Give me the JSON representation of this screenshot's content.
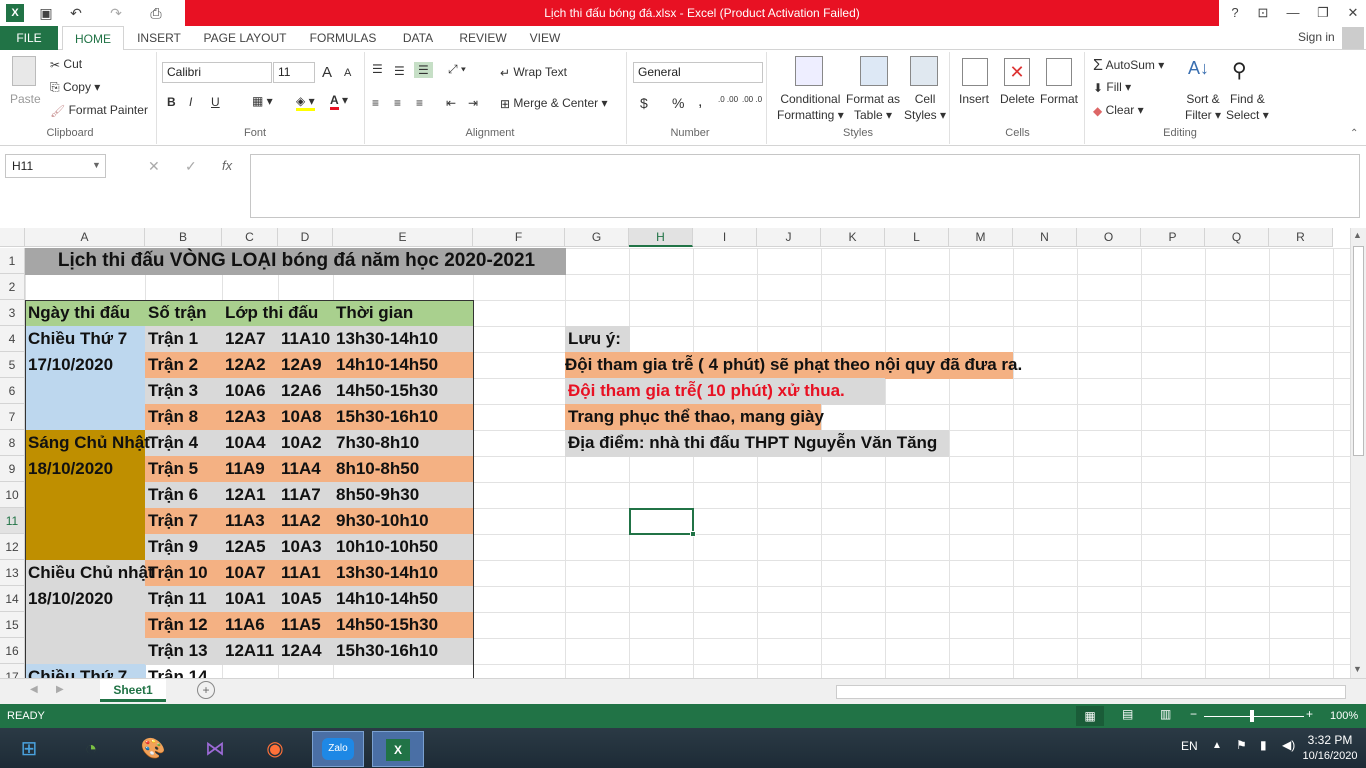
{
  "window": {
    "title": "Lịch thi đấu bóng đá.xlsx -  Excel (Product Activation Failed)",
    "help": "?",
    "signin": "Sign in"
  },
  "tabs": [
    "FILE",
    "HOME",
    "INSERT",
    "PAGE LAYOUT",
    "FORMULAS",
    "DATA",
    "REVIEW",
    "VIEW"
  ],
  "ribbon": {
    "clipboard": {
      "paste": "Paste",
      "cut": "Cut",
      "copy": "Copy",
      "format_painter": "Format Painter",
      "label": "Clipboard"
    },
    "font": {
      "name": "Calibri",
      "size": "11",
      "bold": "B",
      "italic": "I",
      "underline": "U",
      "label": "Font",
      "grow": "A",
      "shrink": "A",
      "color_a": "A"
    },
    "alignment": {
      "wrap": "Wrap Text",
      "merge": "Merge & Center",
      "label": "Alignment"
    },
    "number": {
      "format": "General",
      "currency": "$",
      "percent": "%",
      "comma": ",",
      "label": "Number",
      "inc": ".0 .00",
      "dec": ".00 .0"
    },
    "styles": {
      "conditional": "Conditional",
      "formatting": "Formatting",
      "format_as": "Format as",
      "table": "Table",
      "cell": "Cell",
      "cstyles": "Styles",
      "label": "Styles"
    },
    "cells": {
      "insert": "Insert",
      "delete": "Delete",
      "format": "Format",
      "label": "Cells"
    },
    "editing": {
      "autosum": "AutoSum",
      "fill": "Fill",
      "clear": "Clear",
      "sort": "Sort &",
      "filter": "Filter",
      "find": "Find &",
      "select": "Select",
      "label": "Editing"
    }
  },
  "formula_bar": {
    "name_box": "H11",
    "cancel": "✕",
    "enter": "✓",
    "fx": "fx",
    "value": ""
  },
  "columns": [
    "A",
    "B",
    "C",
    "D",
    "E",
    "F",
    "G",
    "H",
    "I",
    "J",
    "K",
    "L",
    "M",
    "N",
    "O",
    "P",
    "Q",
    "R"
  ],
  "rows": [
    "1",
    "2",
    "3",
    "4",
    "5",
    "6",
    "7",
    "8",
    "9",
    "10",
    "11",
    "12",
    "13",
    "14",
    "15",
    "16",
    "17"
  ],
  "sheet": {
    "title": "Lịch thi đấu VÒNG LOẠI bóng đá năm học 2020-2021",
    "headers": [
      "Ngày thi đấu",
      "Số trận",
      "Lớp thi đấu",
      "Thời gian"
    ],
    "dates": [
      "Chiều Thứ 7",
      "17/10/2020",
      "Sáng Chủ Nhật",
      "18/10/2020",
      "Chiều Chủ nhật",
      "18/10/2020",
      "Chiều Thứ 7"
    ],
    "matches": [
      [
        "Trận 1",
        "12A7",
        "11A10",
        "13h30-14h10"
      ],
      [
        "Trận 2",
        "12A2",
        "12A9",
        "14h10-14h50"
      ],
      [
        "Trận 3",
        "10A6",
        "12A6",
        "14h50-15h30"
      ],
      [
        "Trận 8",
        "12A3",
        "10A8",
        "15h30-16h10"
      ],
      [
        "Trận 4",
        "10A4",
        "10A2",
        "7h30-8h10"
      ],
      [
        "Trận 5",
        "11A9",
        "11A4",
        "8h10-8h50"
      ],
      [
        "Trận 6",
        "12A1",
        "11A7",
        "8h50-9h30"
      ],
      [
        "Trận 7",
        "11A3",
        "11A2",
        "9h30-10h10"
      ],
      [
        "Trận 9",
        "12A5",
        "10A3",
        "10h10-10h50"
      ],
      [
        "Trận 10",
        "10A7",
        "11A1",
        "13h30-14h10"
      ],
      [
        "Trận 11",
        "10A1",
        "10A5",
        "14h10-14h50"
      ],
      [
        "Trận 12",
        "11A6",
        "11A5",
        "14h50-15h30"
      ],
      [
        "Trận 13",
        "12A11",
        "12A4",
        "15h30-16h10"
      ],
      [
        "Trận 14",
        "",
        "",
        ""
      ]
    ],
    "notes": [
      "Lưu ý:",
      "Đội tham gia trễ ( 4 phút) sẽ phạt theo nội quy đã đưa ra.",
      "Đội tham gia trễ( 10 phút) xử thua.",
      "Trang phục thể thao, mang giày",
      "Địa điểm: nhà thi đấu THPT Nguyễn Văn Tăng"
    ]
  },
  "sheet_tab": "Sheet1",
  "status": {
    "ready": "READY",
    "zoom": "100%"
  },
  "taskbar": {
    "lang": "EN",
    "time": "3:32 PM",
    "date": "10/16/2020",
    "zalo": "Zalo"
  },
  "colors": {
    "green": "#217346",
    "red": "#e81123",
    "gray": "#a6a6a6",
    "blue": "#bdd7ee",
    "green_hdr": "#a9d08e",
    "gold": "#bf8f00",
    "salmon": "#f4b183",
    "lightgray": "#d9d9d9"
  }
}
